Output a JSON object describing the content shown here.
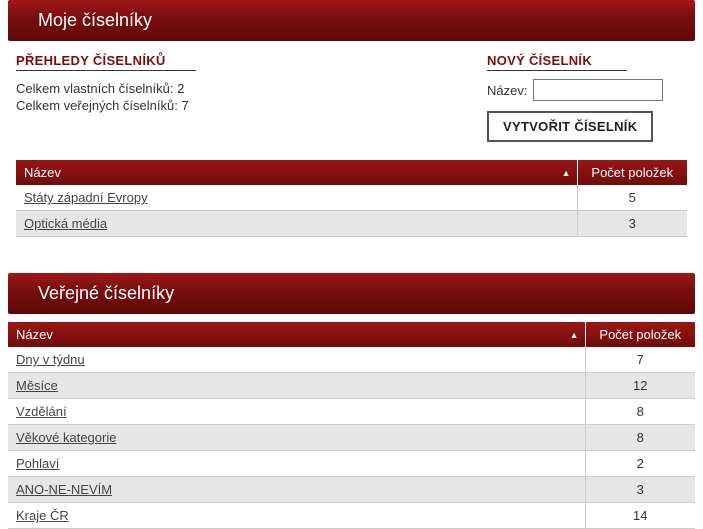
{
  "my": {
    "title": "Moje číselníky",
    "overview_heading": "PŘEHLEDY ČÍSELNÍKŮ",
    "own_label": "Celkem vlastních číselníků:",
    "own_count": "2",
    "public_label": "Celkem veřejných číselníků:",
    "public_count": "7",
    "new_heading": "NOVÝ ČÍSELNÍK",
    "name_label": "Název:",
    "name_value": "",
    "create_button": "VYTVOŘIT ČÍSELNÍK",
    "table": {
      "col_name": "Název",
      "col_count": "Počet položek",
      "rows": [
        {
          "name": "Státy západní Evropy",
          "count": "5"
        },
        {
          "name": "Optická média",
          "count": "3"
        }
      ]
    }
  },
  "public": {
    "title": "Veřejné číselníky",
    "table": {
      "col_name": "Název",
      "col_count": "Počet položek",
      "rows": [
        {
          "name": "Dny v týdnu",
          "count": "7"
        },
        {
          "name": "Měsíce",
          "count": "12"
        },
        {
          "name": "Vzdělání",
          "count": "8"
        },
        {
          "name": "Věkové kategorie",
          "count": "8"
        },
        {
          "name": "Pohlaví",
          "count": "2"
        },
        {
          "name": "ANO-NE-NEVÍM",
          "count": "3"
        },
        {
          "name": "Kraje ČR",
          "count": "14"
        }
      ]
    }
  }
}
